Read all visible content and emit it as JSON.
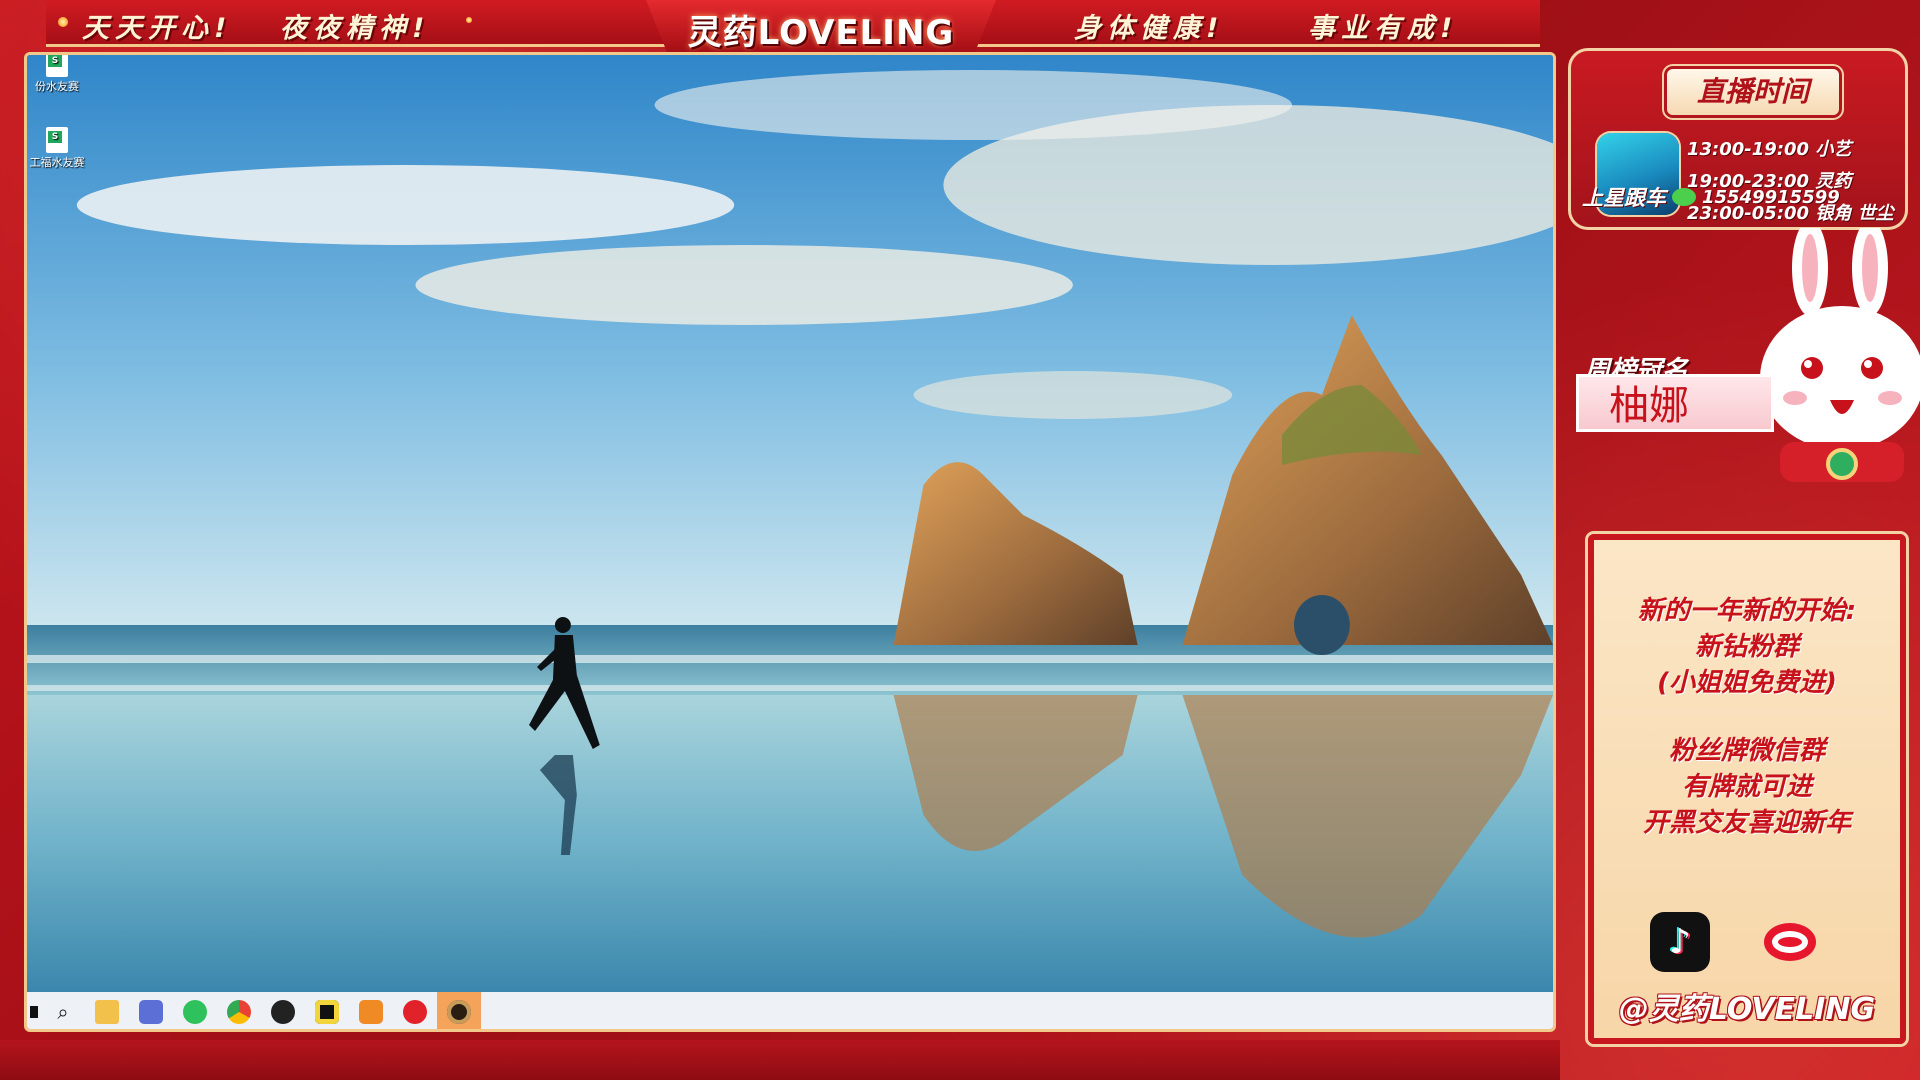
{
  "banner": {
    "slogan_left_1": "天天开心!",
    "slogan_left_2": "夜夜精神!",
    "logo": "灵药LOVELING",
    "slogan_right_1": "身体健康!",
    "slogan_right_2": "事业有成!"
  },
  "desktop": {
    "icons": [
      {
        "label": "份水友赛"
      },
      {
        "label": "工福水友赛"
      }
    ]
  },
  "taskbar": {
    "start_icon": "windows-start-icon",
    "apps": [
      {
        "name": "search-icon",
        "glyph": "⌕"
      },
      {
        "name": "file-explorer-icon",
        "glyph": "▬"
      },
      {
        "name": "game-controller-app-icon",
        "glyph": "◘"
      },
      {
        "name": "wechat-app-icon",
        "glyph": "●"
      },
      {
        "name": "chrome-browser-icon",
        "glyph": "◎"
      },
      {
        "name": "obs-studio-icon",
        "glyph": "◉"
      },
      {
        "name": "yellow-app-icon",
        "glyph": "○"
      },
      {
        "name": "orange-app-icon",
        "glyph": "◆"
      },
      {
        "name": "netease-music-icon",
        "glyph": "◍"
      },
      {
        "name": "obs-active-icon",
        "glyph": "◉"
      }
    ],
    "colors": {
      "accent": "#f5a25a",
      "running": "#1f6fd6"
    }
  },
  "schedule": {
    "title": "直播时间",
    "lines": [
      "13:00-19:00 小艺",
      "19:00-23:00 灵药",
      "23:00-05:00 银角 世尘"
    ],
    "follow_label": "上星跟车",
    "wechat_id": "15549915599"
  },
  "weekly": {
    "label": "周榜冠名",
    "name": "柚娜"
  },
  "notice": {
    "lines": [
      "新的一年新的开始:",
      "新钻粉群",
      "(小姐姐免费进)",
      "粉丝牌微信群",
      "有牌就可进",
      "开黑交友喜迎新年"
    ],
    "handle": "@灵药LOVELING"
  },
  "theme": {
    "red": "#c4141d",
    "gold": "#f2c98a",
    "cream": "#fbe6c6"
  }
}
